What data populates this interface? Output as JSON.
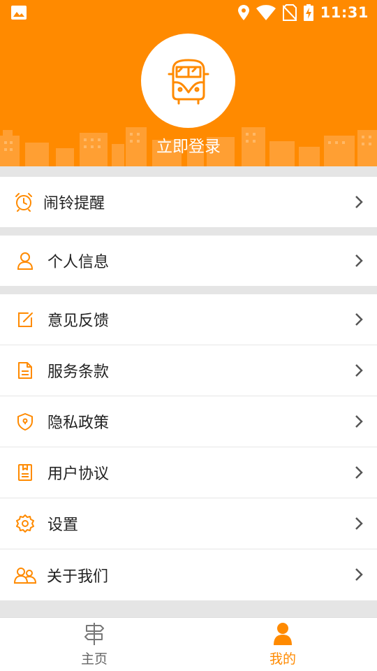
{
  "status_bar": {
    "time": "11:31",
    "icons": [
      "image-icon",
      "location-icon",
      "wifi-icon",
      "no-sim-icon",
      "battery-charging-icon"
    ]
  },
  "header": {
    "avatar_icon": "bus-icon",
    "login_label": "立即登录"
  },
  "colors": {
    "accent": "#ff8a00",
    "background": "#e5e5e5"
  },
  "menu": {
    "group1": [
      {
        "label": "闹铃提醒",
        "icon": "alarm-clock-icon"
      }
    ],
    "group2": [
      {
        "label": "个人信息",
        "icon": "person-icon"
      }
    ],
    "group3": [
      {
        "label": "意见反馈",
        "icon": "feedback-icon"
      },
      {
        "label": "服务条款",
        "icon": "document-icon"
      },
      {
        "label": "隐私政策",
        "icon": "shield-icon"
      },
      {
        "label": "用户协议",
        "icon": "agreement-icon"
      },
      {
        "label": "设置",
        "icon": "gear-icon"
      },
      {
        "label": "关于我们",
        "icon": "group-icon"
      }
    ]
  },
  "bottom_nav": {
    "items": [
      {
        "label": "主页",
        "icon": "signpost-icon",
        "active": false
      },
      {
        "label": "我的",
        "icon": "user-icon",
        "active": true
      }
    ]
  }
}
